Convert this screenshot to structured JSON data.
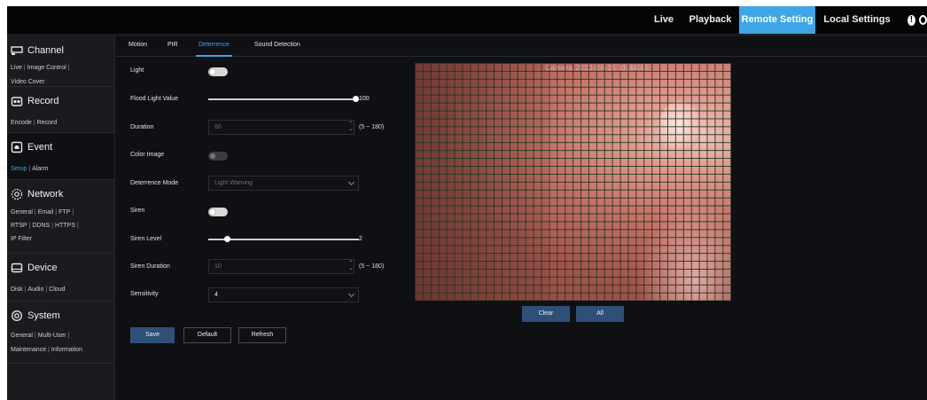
{
  "topnav": {
    "items": [
      {
        "label": "Live"
      },
      {
        "label": "Playback"
      },
      {
        "label": "Remote Setting"
      },
      {
        "label": "Local Settings"
      }
    ]
  },
  "sidebar": {
    "channel": {
      "title": "Channel",
      "links": [
        "Live",
        "Image Control",
        "Video Cover"
      ]
    },
    "record": {
      "title": "Record",
      "links": [
        "Encode",
        "Record"
      ]
    },
    "event": {
      "title": "Event",
      "links": [
        "Setup",
        "Alarm"
      ]
    },
    "network": {
      "title": "Network",
      "links": [
        "General",
        "Email",
        "FTP",
        "RTSP",
        "DDNS",
        "HTTPS",
        "IP Filter"
      ]
    },
    "device": {
      "title": "Device",
      "links": [
        "Disk",
        "Audio",
        "Cloud"
      ]
    },
    "system": {
      "title": "System",
      "links": [
        "General",
        "Multi-User",
        "Maintenance",
        "Information"
      ]
    },
    "separator": "|"
  },
  "tabs": [
    {
      "label": "Motion"
    },
    {
      "label": "PIR"
    },
    {
      "label": "Deterrence"
    },
    {
      "label": "Sound Detection"
    }
  ],
  "form": {
    "light": {
      "label": "Light",
      "on": true
    },
    "flood_light_value": {
      "label": "Flood Light Value",
      "value": 100,
      "max": 100
    },
    "duration": {
      "label": "Duration",
      "value": "60",
      "hint": "(5 ~ 180)"
    },
    "color_image": {
      "label": "Color Image",
      "on": false
    },
    "deterrence_mode": {
      "label": "Deterrence Mode",
      "value": "Light Warning"
    },
    "siren": {
      "label": "Siren",
      "on": true
    },
    "siren_level": {
      "label": "Siren Level",
      "value": 2,
      "min": 1,
      "max": 10
    },
    "siren_duration": {
      "label": "Siren Duration",
      "value": "10",
      "hint": "(5 ~ 180)"
    },
    "sensitivity": {
      "label": "Sensitivity",
      "value": "4"
    },
    "spin_up": "⌃",
    "spin_down": "⌄"
  },
  "buttons": {
    "save": "Save",
    "default": "Default",
    "refresh": "Refresh",
    "clear": "Clear",
    "all": "All"
  },
  "video": {
    "osd": "Camera   2022-04-15 11:44:45"
  },
  "colors": {
    "accent": "#3ea6e6",
    "primary_button": "#2e4f77",
    "grid_line": "#1c3c18"
  }
}
